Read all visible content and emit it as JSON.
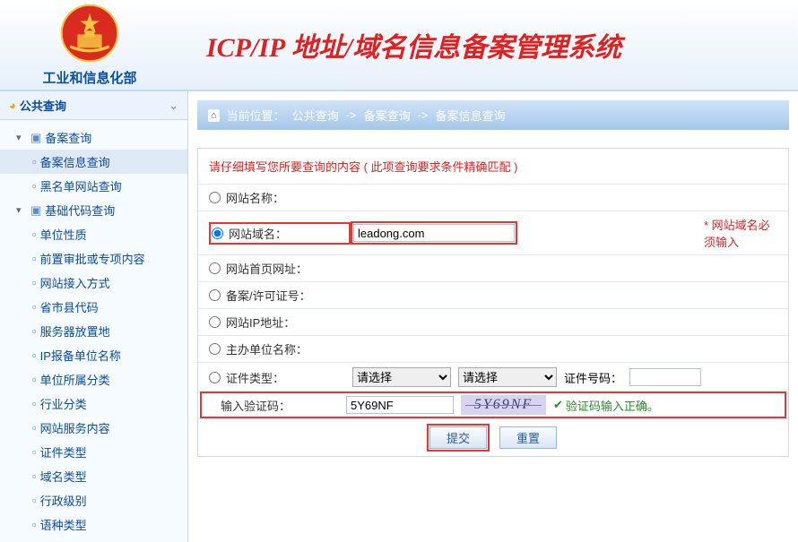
{
  "header": {
    "org_name": "工业和信息化部",
    "title": "ICP/IP 地址/域名信息备案管理系统"
  },
  "sidebar": {
    "title": "公共查询",
    "group1": "备案查询",
    "items1": [
      "备案信息查询",
      "黑名单网站查询"
    ],
    "group2": "基础代码查询",
    "items2": [
      "单位性质",
      "前置审批或专项内容",
      "网站接入方式",
      "省市县代码",
      "服务器放置地",
      "IP报备单位名称",
      "单位所属分类",
      "行业分类",
      "网站服务内容",
      "证件类型",
      "域名类型",
      "行政级别",
      "语种类型"
    ]
  },
  "breadcrumb": {
    "label": "当前位置：",
    "p0": "公共查询",
    "p1": "备案查询",
    "p2": "备案信息查询",
    "sep": "->"
  },
  "form": {
    "hint": "请仔细填写您所要查询的内容 ( 此项查询要求条件精确匹配 )",
    "labels": {
      "site_name": "网站名称：",
      "domain": "网站域名：",
      "homepage": "网站首页网址：",
      "license": "备案/许可证号：",
      "ip": "网站IP地址：",
      "sponsor": "主办单位名称：",
      "cert_type": "证件类型：",
      "cert_no": "证件号码：",
      "captcha": "输入验证码："
    },
    "values": {
      "domain": "leadong.com",
      "captcha": "5Y69NF"
    },
    "select_placeholder": "请选择",
    "required_msg": "* 网站域名必须输入",
    "captcha_image": "5Y69NF",
    "captcha_ok": "验证码输入正确。",
    "submit": "提交",
    "reset": "重置"
  }
}
